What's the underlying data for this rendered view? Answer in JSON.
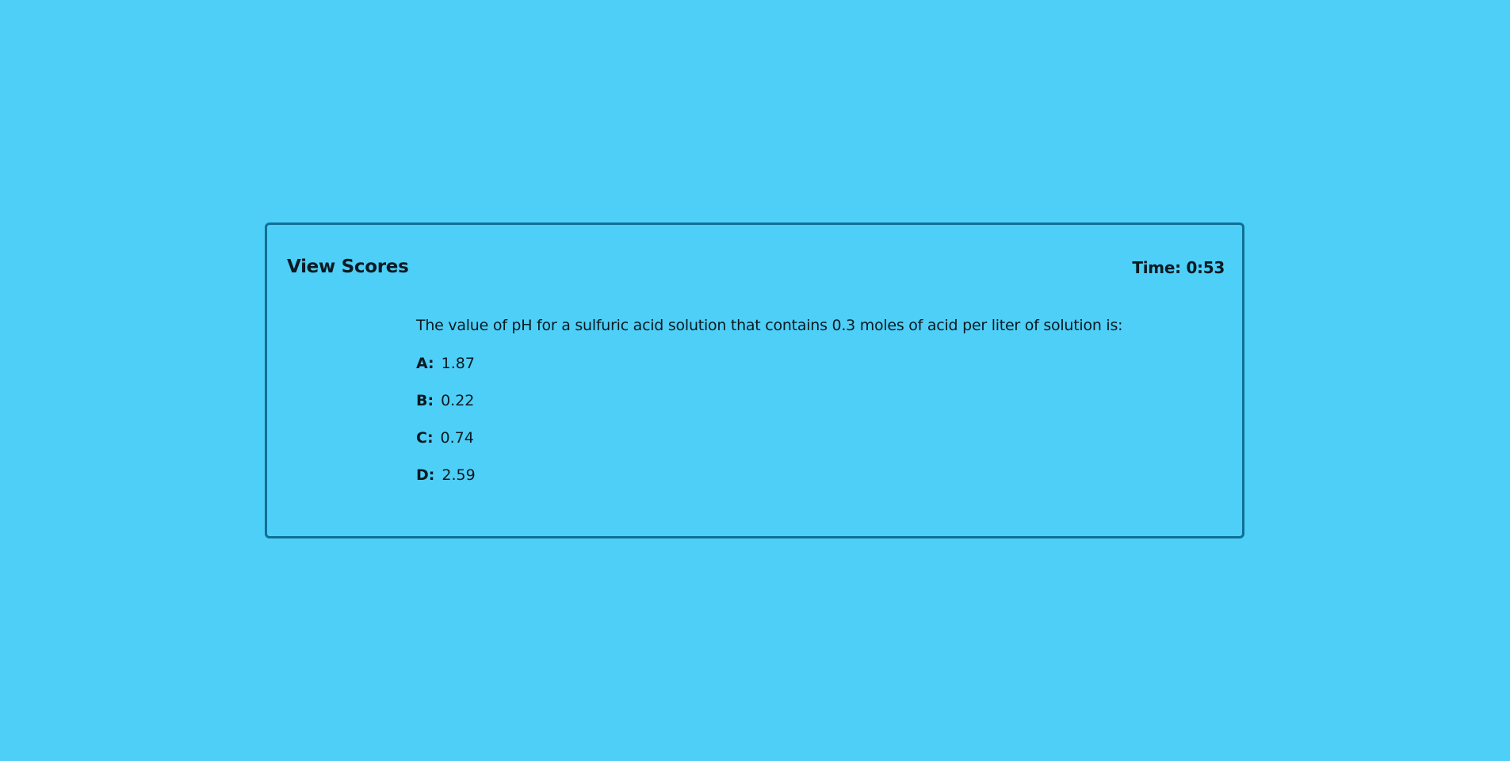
{
  "header": {
    "view_scores_label": "View Scores",
    "timer_text": "Time: 0:53"
  },
  "question": {
    "text": "The value of pH for a sulfuric acid solution that contains 0.3 moles of acid per liter of solution is:",
    "answers": [
      {
        "letter": "A:",
        "value": "1.87"
      },
      {
        "letter": "B:",
        "value": "0.22"
      },
      {
        "letter": "C:",
        "value": "0.74"
      },
      {
        "letter": "D:",
        "value": "2.59"
      }
    ]
  },
  "colors": {
    "background": "#4ecff7",
    "card_border": "#0f6f95",
    "text": "#0b1a22"
  }
}
